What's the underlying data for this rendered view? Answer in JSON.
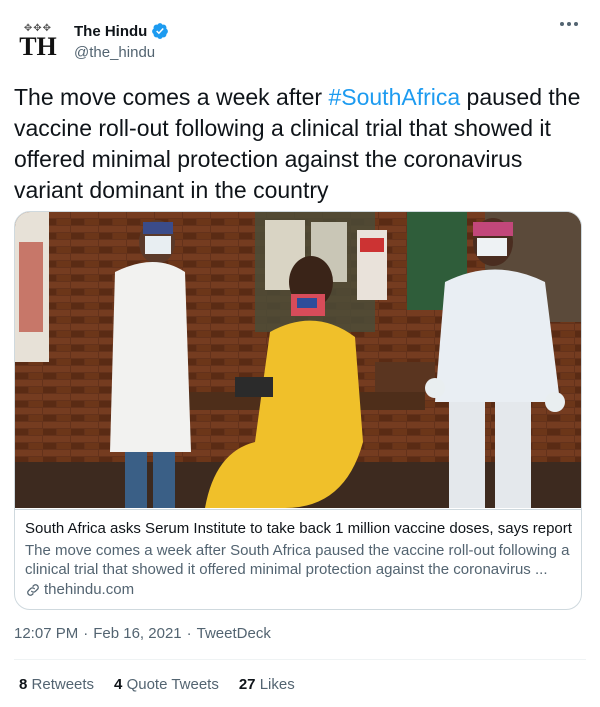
{
  "account": {
    "name": "The Hindu",
    "handle": "@the_hindu",
    "avatar_monogram": "TH",
    "verified": true,
    "verified_color": "#1d9bf0"
  },
  "menu_icon": "more-horizontal-icon",
  "tweet": {
    "text_before": "The move comes a week after ",
    "hashtag": "#SouthAfrica",
    "text_after": " paused the vaccine roll-out following a clinical trial that showed it offered minimal protection against the coronavirus variant dominant in the country"
  },
  "card": {
    "title": "South Africa asks Serum Institute to take back 1 million vaccine doses, says report",
    "description": "The move comes a week after South Africa paused the vaccine roll-out following a clinical trial that showed it offered minimal protection against the coronavirus ...",
    "domain": "thehindu.com",
    "link_icon": "link-icon"
  },
  "meta": {
    "time": "12:07 PM",
    "date": "Feb 16, 2021",
    "separator": "·",
    "source": "TweetDeck"
  },
  "stats": {
    "retweets_count": "8",
    "retweets_label": "Retweets",
    "quotes_count": "4",
    "quotes_label": "Quote Tweets",
    "likes_count": "27",
    "likes_label": "Likes"
  },
  "colors": {
    "link": "#1d9bf0",
    "secondary_text": "#536471",
    "border": "#cfd9de"
  }
}
